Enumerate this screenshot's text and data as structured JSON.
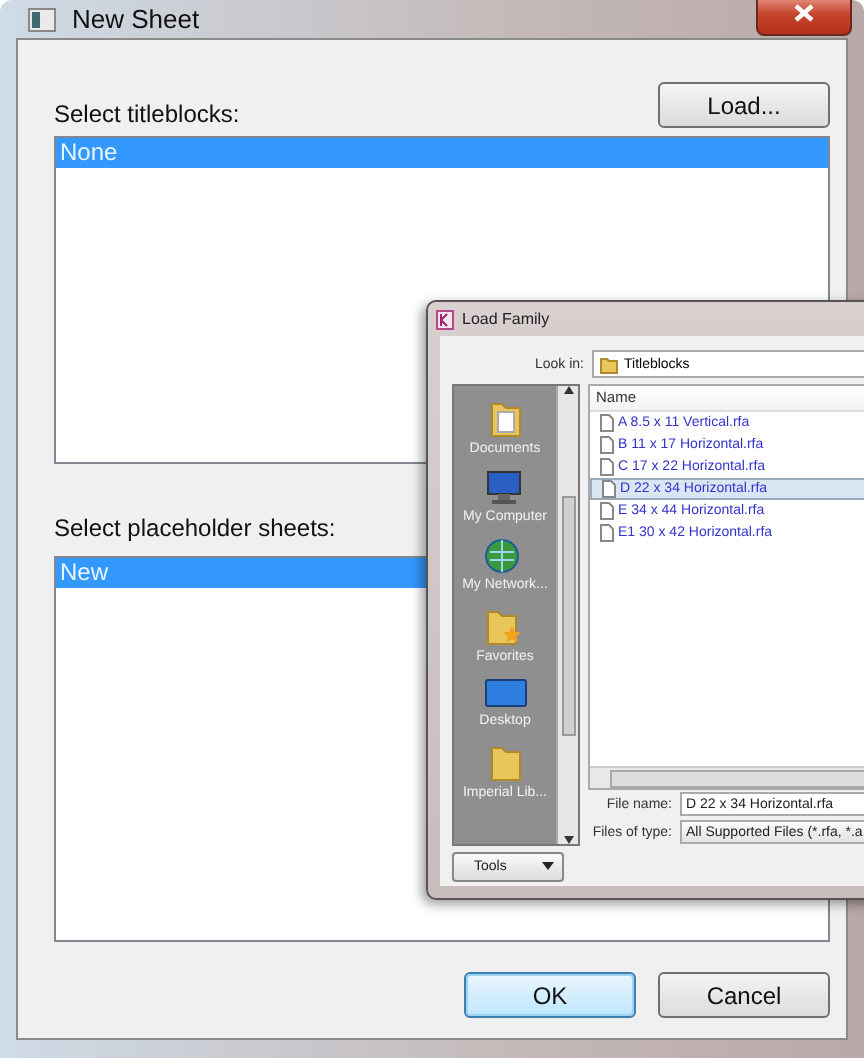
{
  "window": {
    "title": "New Sheet"
  },
  "titleblocks": {
    "label": "Select titleblocks:",
    "load_button": "Load...",
    "items": [
      {
        "label": "None",
        "selected": true
      }
    ]
  },
  "placeholders": {
    "label": "Select placeholder sheets:",
    "items": [
      {
        "label": "New",
        "selected": true
      }
    ]
  },
  "buttons": [
    {
      "label": "OK",
      "default": true
    },
    {
      "label": "Cancel",
      "default": false
    }
  ],
  "load_family": {
    "title": "Load Family",
    "look_in_label": "Look in:",
    "look_in": "Titleblocks",
    "places": [
      {
        "label": "Documents",
        "kind": "documents"
      },
      {
        "label": "My Computer",
        "kind": "computer"
      },
      {
        "label": "My Network...",
        "kind": "network"
      },
      {
        "label": "Favorites",
        "kind": "favorites"
      },
      {
        "label": "Desktop",
        "kind": "desktop"
      },
      {
        "label": "Imperial Lib...",
        "kind": "folder"
      }
    ],
    "column": "Name",
    "files": [
      {
        "name": "A 8.5 x 11 Vertical.rfa",
        "selected": false
      },
      {
        "name": "B 11 x 17 Horizontal.rfa",
        "selected": false
      },
      {
        "name": "C 17 x 22 Horizontal.rfa",
        "selected": false
      },
      {
        "name": "D 22 x 34 Horizontal.rfa",
        "selected": true
      },
      {
        "name": "E 34 x 44 Horizontal.rfa",
        "selected": false
      },
      {
        "name": "E1 30 x 42 Horizontal.rfa",
        "selected": false
      }
    ],
    "file_name_label": "File name:",
    "file_name": "D 22 x 34 Horizontal.rfa",
    "file_type_label": "Files of type:",
    "file_type": "All Supported Files  (*.rfa, *.a",
    "tools": "Tools"
  }
}
